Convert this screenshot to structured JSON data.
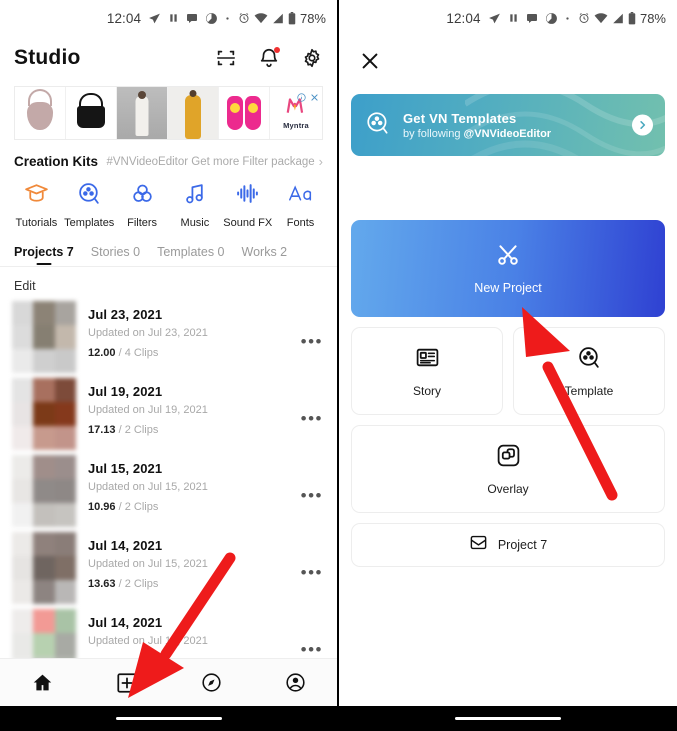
{
  "status_bar": {
    "time": "12:04",
    "battery": "78%",
    "left_icons": [
      "send-icon",
      "pause-icon",
      "message-icon",
      "clock-pie-icon",
      "dot-icon"
    ],
    "right_icons": [
      "alarm-icon",
      "wifi-icon",
      "signal-icon",
      "battery-icon"
    ]
  },
  "left_screen": {
    "header": {
      "title": "Studio",
      "icons": [
        "scan-icon",
        "bell-icon",
        "gear-icon"
      ]
    },
    "ad": {
      "brand": "Myntra",
      "info_icon": "info-icon",
      "close_icon": "close-icon",
      "products": [
        "handbag-pink",
        "handbag-black",
        "model-white-dress",
        "model-yellow-dress",
        "pink-slides"
      ]
    },
    "creation_kits": {
      "title": "Creation Kits",
      "promo": "#VNVideoEditor Get more Filter package",
      "promo_chevron": "chevron-right-icon",
      "items": [
        {
          "label": "Tutorials",
          "icon": "graduation-cap-icon",
          "color": "#f08a34"
        },
        {
          "label": "Templates",
          "icon": "film-reel-icon",
          "color": "#3b69e8"
        },
        {
          "label": "Filters",
          "icon": "three-circles-icon",
          "color": "#3b69e8"
        },
        {
          "label": "Music",
          "icon": "music-note-icon",
          "color": "#3b69e8"
        },
        {
          "label": "Sound FX",
          "icon": "waveform-icon",
          "color": "#3b69e8"
        },
        {
          "label": "Fonts",
          "icon": "text-aa-icon",
          "color": "#3b69e8"
        }
      ]
    },
    "tabs": [
      {
        "label": "Projects 7",
        "active": true
      },
      {
        "label": "Stories 0",
        "active": false
      },
      {
        "label": "Templates 0",
        "active": false
      },
      {
        "label": "Works 2",
        "active": false
      }
    ],
    "edit_label": "Edit",
    "projects": [
      {
        "title": "Jul 23, 2021",
        "updated": "Updated on Jul 23, 2021",
        "duration": "12.00",
        "clips": "4 Clips",
        "colors": [
          "#d8d8d8",
          "#8c8376",
          "#a8a49f",
          "#dcdcdc",
          "#867f72",
          "#c3b8ac",
          "#eaeaea",
          "#cfcfcf",
          "#c9c9c9"
        ]
      },
      {
        "title": "Jul 19, 2021",
        "updated": "Updated on Jul 19, 2021",
        "duration": "17.13",
        "clips": "2 Clips",
        "colors": [
          "#e4e4e4",
          "#a8705f",
          "#7d4b3a",
          "#e8e4e4",
          "#7c3a18",
          "#85391c",
          "#f0eaea",
          "#c79a8d",
          "#c2948a"
        ]
      },
      {
        "title": "Jul 15, 2021",
        "updated": "Updated on Jul 15, 2021",
        "duration": "10.96",
        "clips": "2 Clips",
        "colors": [
          "#ecebe9",
          "#a08e8a",
          "#9b8e8c",
          "#e8e6e4",
          "#8f8a88",
          "#8e8886",
          "#f1f1f1",
          "#c3c0bc",
          "#c6c4c0"
        ]
      },
      {
        "title": "Jul 14, 2021",
        "updated": "Updated on Jul 15, 2021",
        "duration": "13.63",
        "clips": "2 Clips",
        "colors": [
          "#eceae8",
          "#8f817c",
          "#8a7d78",
          "#e6e4e2",
          "#6f6560",
          "#7f6f66",
          "#ebe9e7",
          "#8d8481",
          "#b9b7b6"
        ]
      },
      {
        "title": "Jul 14, 2021",
        "updated": "Updated on Jul 15, 2021",
        "duration": "",
        "clips": "",
        "colors": [
          "#eeeceb",
          "#f29a95",
          "#a9c3a6",
          "#e9e9e7",
          "#b7d1b0",
          "#a8aaa4",
          "#ececea",
          "#c9cfc6",
          "#b6bab2"
        ]
      }
    ],
    "bottom_nav": [
      {
        "name": "home",
        "icon": "home-icon",
        "active": true
      },
      {
        "name": "create",
        "icon": "plus-box-icon",
        "active": false
      },
      {
        "name": "explore",
        "icon": "compass-icon",
        "active": false
      },
      {
        "name": "profile",
        "icon": "account-icon",
        "active": false
      }
    ]
  },
  "right_screen": {
    "close_icon": "close-icon",
    "vn_banner": {
      "title": "Get VN Templates",
      "subtitle_prefix": "by following ",
      "handle": "@VNVideoEditor",
      "left_icon": "film-reel-icon",
      "arrow_icon": "chevron-right-icon"
    },
    "new_project": {
      "label": "New Project",
      "icon": "scissors-icon"
    },
    "cards": [
      {
        "label": "Story",
        "icon": "story-card-icon"
      },
      {
        "label": "Template",
        "icon": "film-reel-icon"
      },
      {
        "label": "Overlay",
        "icon": "overlay-icon"
      }
    ],
    "project_button": {
      "label": "Project 7",
      "icon": "inbox-icon"
    }
  },
  "annotations": {
    "arrow_color": "#ee1b1b",
    "arrows": [
      "arrow-to-plus-nav",
      "arrow-to-new-project"
    ]
  }
}
